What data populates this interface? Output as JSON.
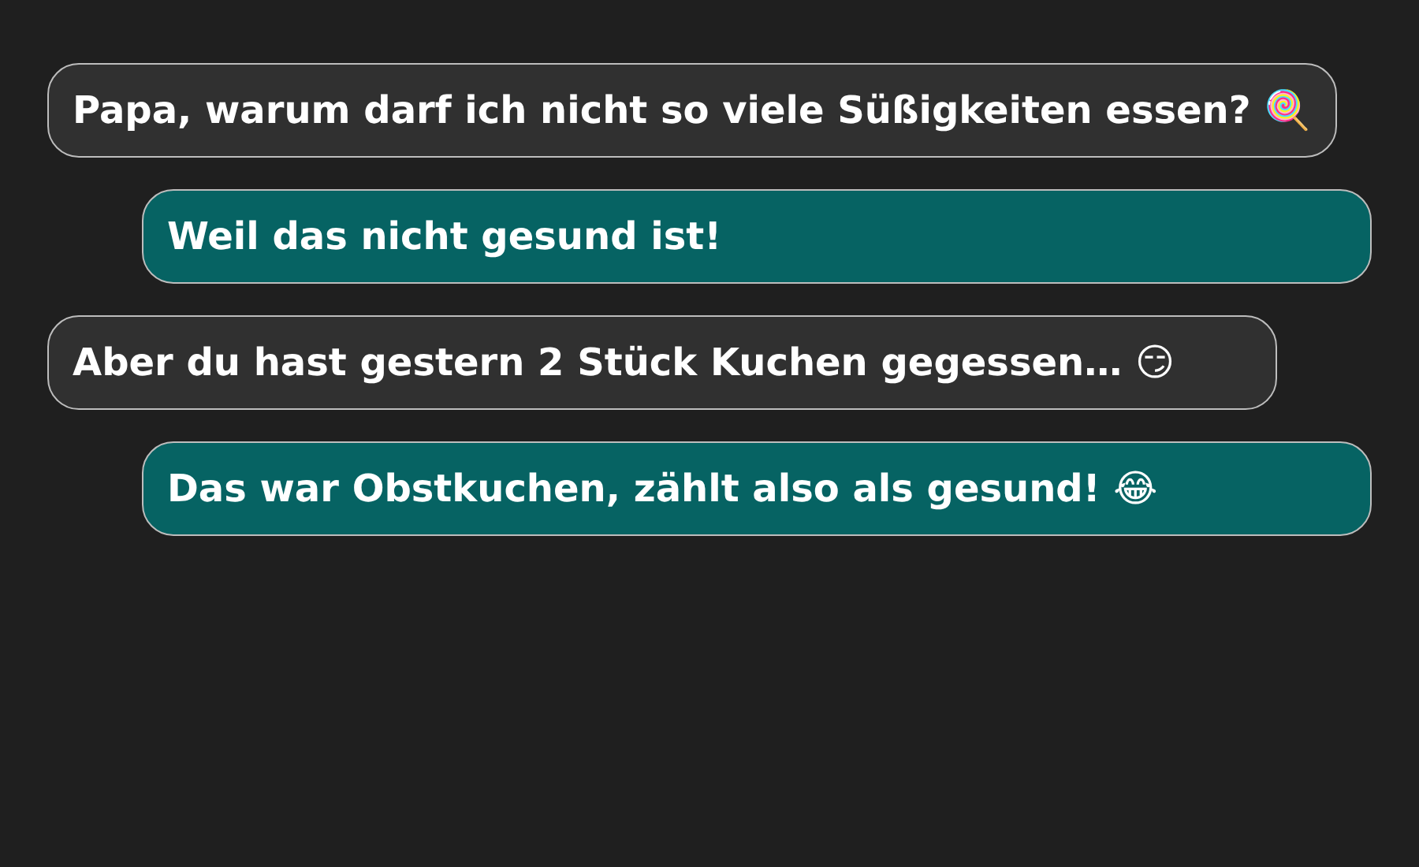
{
  "messages": [
    {
      "kind": "incoming",
      "text": "Papa, warum darf ich nicht so viele Süßigkeiten essen? 🍭"
    },
    {
      "kind": "outgoing",
      "text": "Weil das nicht gesund ist!"
    },
    {
      "kind": "incoming",
      "text": "Aber du hast gestern 2 Stück Kuchen gegessen… 😏"
    },
    {
      "kind": "outgoing",
      "text": "Das war Obstkuchen, zählt also als gesund! 😂"
    }
  ]
}
